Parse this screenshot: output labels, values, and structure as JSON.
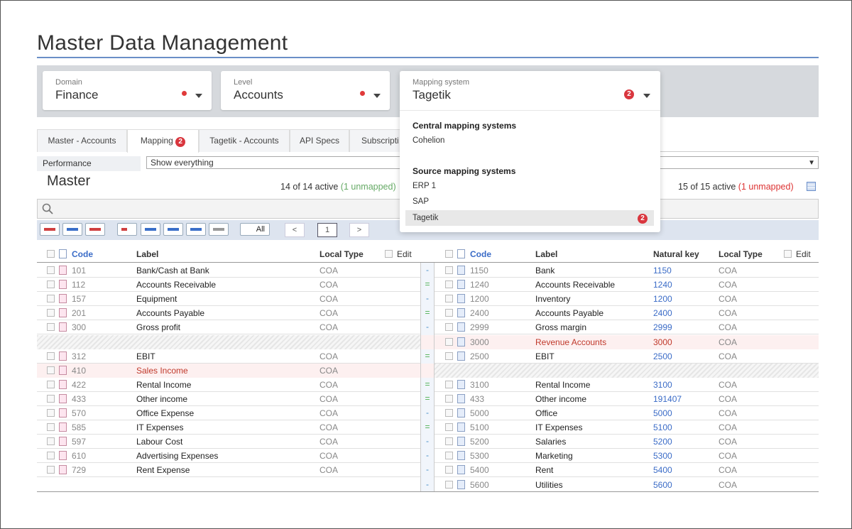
{
  "app": {
    "title": "Master Data Management"
  },
  "selectors": {
    "domain": {
      "label": "Domain",
      "value": "Finance"
    },
    "level": {
      "label": "Level",
      "value": "Accounts"
    },
    "mapping_system": {
      "label": "Mapping system",
      "value": "Tagetik",
      "badge": "2"
    }
  },
  "tabs": [
    {
      "label": "Master - Accounts"
    },
    {
      "label": "Mapping",
      "badge": "2"
    },
    {
      "label": "Tagetik - Accounts"
    },
    {
      "label": "API Specs"
    },
    {
      "label": "Subscripti"
    }
  ],
  "filter": {
    "label": "Performance",
    "value": "Show everything"
  },
  "left": {
    "title": "Master",
    "active_text": "14 of 14 active",
    "unmapped_text": "(1 unmapped)",
    "columns": {
      "code": "Code",
      "label": "Label",
      "local_type": "Local Type",
      "edit": "Edit"
    }
  },
  "right": {
    "active_text": "15 of 15 active",
    "unmapped_text": "(1 unmapped)",
    "columns": {
      "code": "Code",
      "label": "Label",
      "natural_key": "Natural key",
      "local_type": "Local Type",
      "edit": "Edit"
    }
  },
  "toolbar": {
    "all_label": "All",
    "prev": "<",
    "page": "1",
    "next": ">"
  },
  "rows": [
    {
      "lcode": "101",
      "llabel": "Bank/Cash at Bank",
      "ltype": "COA",
      "map": "-",
      "rcode": "1150",
      "rlabel": "Bank",
      "rkey": "1150",
      "rtype": "COA"
    },
    {
      "lcode": "112",
      "llabel": "Accounts Receivable",
      "ltype": "COA",
      "map": "=",
      "rcode": "1240",
      "rlabel": "Accounts Receivable",
      "rkey": "1240",
      "rtype": "COA"
    },
    {
      "lcode": "157",
      "llabel": "Equipment",
      "ltype": "COA",
      "map": "-",
      "rcode": "1200",
      "rlabel": "Inventory",
      "rkey": "1200",
      "rtype": "COA"
    },
    {
      "lcode": "201",
      "llabel": "Accounts Payable",
      "ltype": "COA",
      "map": "=",
      "rcode": "2400",
      "rlabel": "Accounts Payable",
      "rkey": "2400",
      "rtype": "COA"
    },
    {
      "lcode": "300",
      "llabel": "Gross profit",
      "ltype": "COA",
      "map": "-",
      "rcode": "2999",
      "rlabel": "Gross margin",
      "rkey": "2999",
      "rtype": "COA"
    },
    {
      "lcode": "",
      "llabel": "",
      "ltype": "",
      "map": "",
      "rcode": "3000",
      "rlabel": "Revenue Accounts",
      "rkey": "3000",
      "rtype": "COA"
    },
    {
      "lcode": "312",
      "llabel": "EBIT",
      "ltype": "COA",
      "map": "=",
      "rcode": "2500",
      "rlabel": "EBIT",
      "rkey": "2500",
      "rtype": "COA"
    },
    {
      "lcode": "410",
      "llabel": "Sales Income",
      "ltype": "COA",
      "map": "",
      "rcode": "",
      "rlabel": "",
      "rkey": "",
      "rtype": ""
    },
    {
      "lcode": "422",
      "llabel": "Rental Income",
      "ltype": "COA",
      "map": "=",
      "rcode": "3100",
      "rlabel": "Rental Income",
      "rkey": "3100",
      "rtype": "COA"
    },
    {
      "lcode": "433",
      "llabel": "Other income",
      "ltype": "COA",
      "map": "=",
      "rcode": "433",
      "rlabel": "Other income",
      "rkey": "191407",
      "rtype": "COA"
    },
    {
      "lcode": "570",
      "llabel": "Office Expense",
      "ltype": "COA",
      "map": "-",
      "rcode": "5000",
      "rlabel": "Office",
      "rkey": "5000",
      "rtype": "COA"
    },
    {
      "lcode": "585",
      "llabel": "IT Expenses",
      "ltype": "COA",
      "map": "=",
      "rcode": "5100",
      "rlabel": "IT Expenses",
      "rkey": "5100",
      "rtype": "COA"
    },
    {
      "lcode": "597",
      "llabel": "Labour Cost",
      "ltype": "COA",
      "map": "-",
      "rcode": "5200",
      "rlabel": "Salaries",
      "rkey": "5200",
      "rtype": "COA"
    },
    {
      "lcode": "610",
      "llabel": "Advertising Expenses",
      "ltype": "COA",
      "map": "-",
      "rcode": "5300",
      "rlabel": "Marketing",
      "rkey": "5300",
      "rtype": "COA"
    },
    {
      "lcode": "729",
      "llabel": "Rent Expense",
      "ltype": "COA",
      "map": "-",
      "rcode": "5400",
      "rlabel": "Rent",
      "rkey": "5400",
      "rtype": "COA"
    },
    {
      "lcode": "",
      "llabel": "",
      "ltype": "",
      "map": "-",
      "rcode": "5600",
      "rlabel": "Utilities",
      "rkey": "5600",
      "rtype": "COA"
    }
  ],
  "dropdown": {
    "central_header": "Central mapping systems",
    "central_items": [
      "Cohelion"
    ],
    "source_header": "Source mapping systems",
    "source_items": [
      "ERP 1",
      "SAP",
      "Tagetik"
    ],
    "selected_badge": "2"
  },
  "colors": {
    "accent": "#3b6cc7",
    "error": "#d9363e",
    "unmapped": "#c0392b"
  }
}
